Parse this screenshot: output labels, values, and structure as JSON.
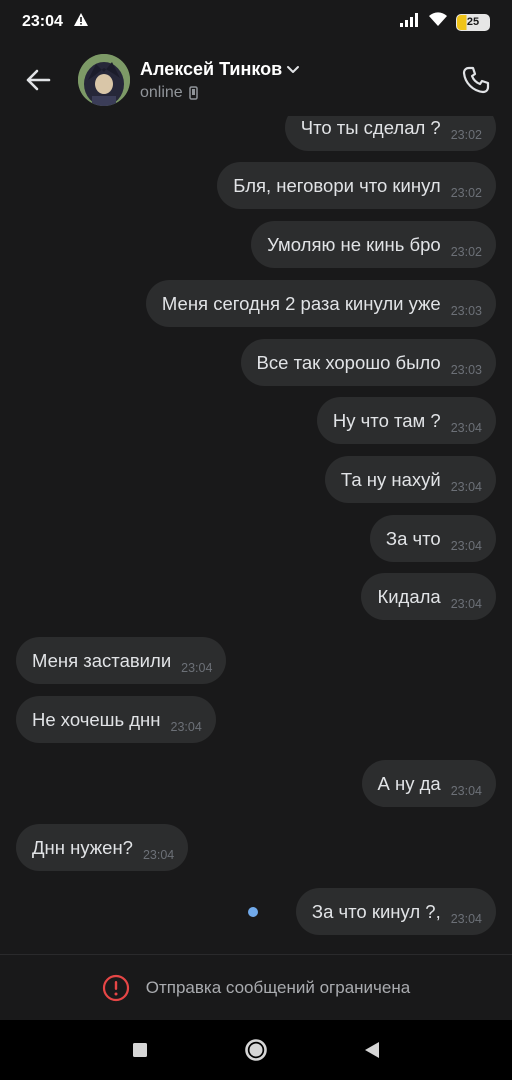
{
  "status_bar": {
    "time": "23:04",
    "battery": "25"
  },
  "header": {
    "name": "Алексей Тинков",
    "status": "online"
  },
  "messages": [
    {
      "text": "Что ты сделал ?",
      "time": "23:02",
      "side": "out"
    },
    {
      "text": "Бля, неговори что кинул",
      "time": "23:02",
      "side": "out"
    },
    {
      "text": "Умоляю не кинь бро",
      "time": "23:02",
      "side": "out"
    },
    {
      "text": "Меня сегодня 2 раза кинули уже",
      "time": "23:03",
      "side": "out"
    },
    {
      "text": "Все так хорошо было",
      "time": "23:03",
      "side": "out"
    },
    {
      "text": "Ну что там ?",
      "time": "23:04",
      "side": "out"
    },
    {
      "text": "Та ну нахуй",
      "time": "23:04",
      "side": "out"
    },
    {
      "text": "За что",
      "time": "23:04",
      "side": "out"
    },
    {
      "text": "Кидала",
      "time": "23:04",
      "side": "out"
    },
    {
      "text": "Меня заставили",
      "time": "23:04",
      "side": "in"
    },
    {
      "text": "Не хочешь днн",
      "time": "23:04",
      "side": "in"
    },
    {
      "text": "А ну да",
      "time": "23:04",
      "side": "out"
    },
    {
      "text": "Днн нужен?",
      "time": "23:04",
      "side": "in"
    },
    {
      "text": "За что кинул ?,",
      "time": "23:04",
      "side": "out",
      "unread": true
    }
  ],
  "restriction": {
    "text": "Отправка сообщений ограничена"
  },
  "colors": {
    "background": "#19191a",
    "bubble": "#2c2d2e",
    "accent": "#71aaeb",
    "warning": "#e64646"
  },
  "icons": {
    "back": "arrow-left-icon",
    "call": "phone-icon",
    "dropdown": "chevron-down-icon",
    "device": "mobile-device-icon",
    "warning": "exclamation-circle-icon",
    "nav_recent": "square-icon",
    "nav_home": "circle-icon",
    "nav_back": "triangle-left-icon"
  }
}
